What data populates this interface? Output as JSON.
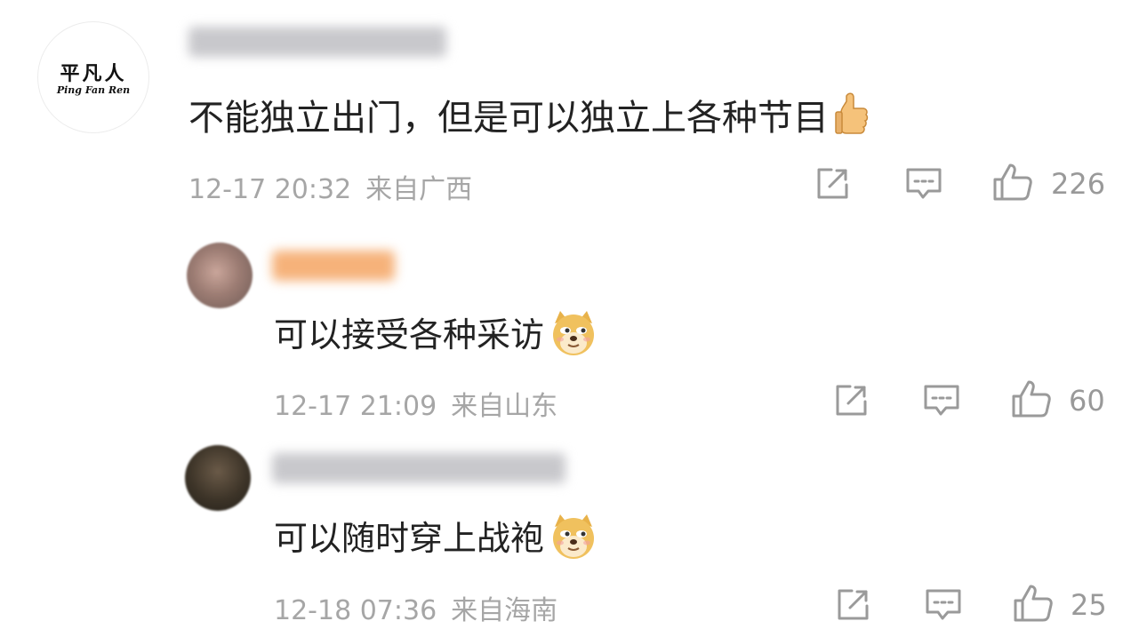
{
  "comments": [
    {
      "avatar_text_cn": "平凡人",
      "avatar_text_en": "Ping Fan Ren",
      "text": "不能独立出门，但是可以独立上各种节目",
      "emoji": "thumbs-up",
      "date": "12-17 20:32",
      "location": "来自广西",
      "likes": "226"
    },
    {
      "text": "可以接受各种采访",
      "emoji": "doge",
      "date": "12-17 21:09",
      "location": "来自山东",
      "likes": "60"
    },
    {
      "text": "可以随时穿上战袍",
      "emoji": "doge",
      "date": "12-18 07:36",
      "location": "来自海南",
      "likes": "25"
    }
  ],
  "icons": {
    "repost": "repost-icon",
    "comment": "comment-icon",
    "like": "thumbs-up-icon"
  },
  "colors": {
    "text": "#222222",
    "meta": "#a6a6a6",
    "icon": "#9a9a9a"
  }
}
